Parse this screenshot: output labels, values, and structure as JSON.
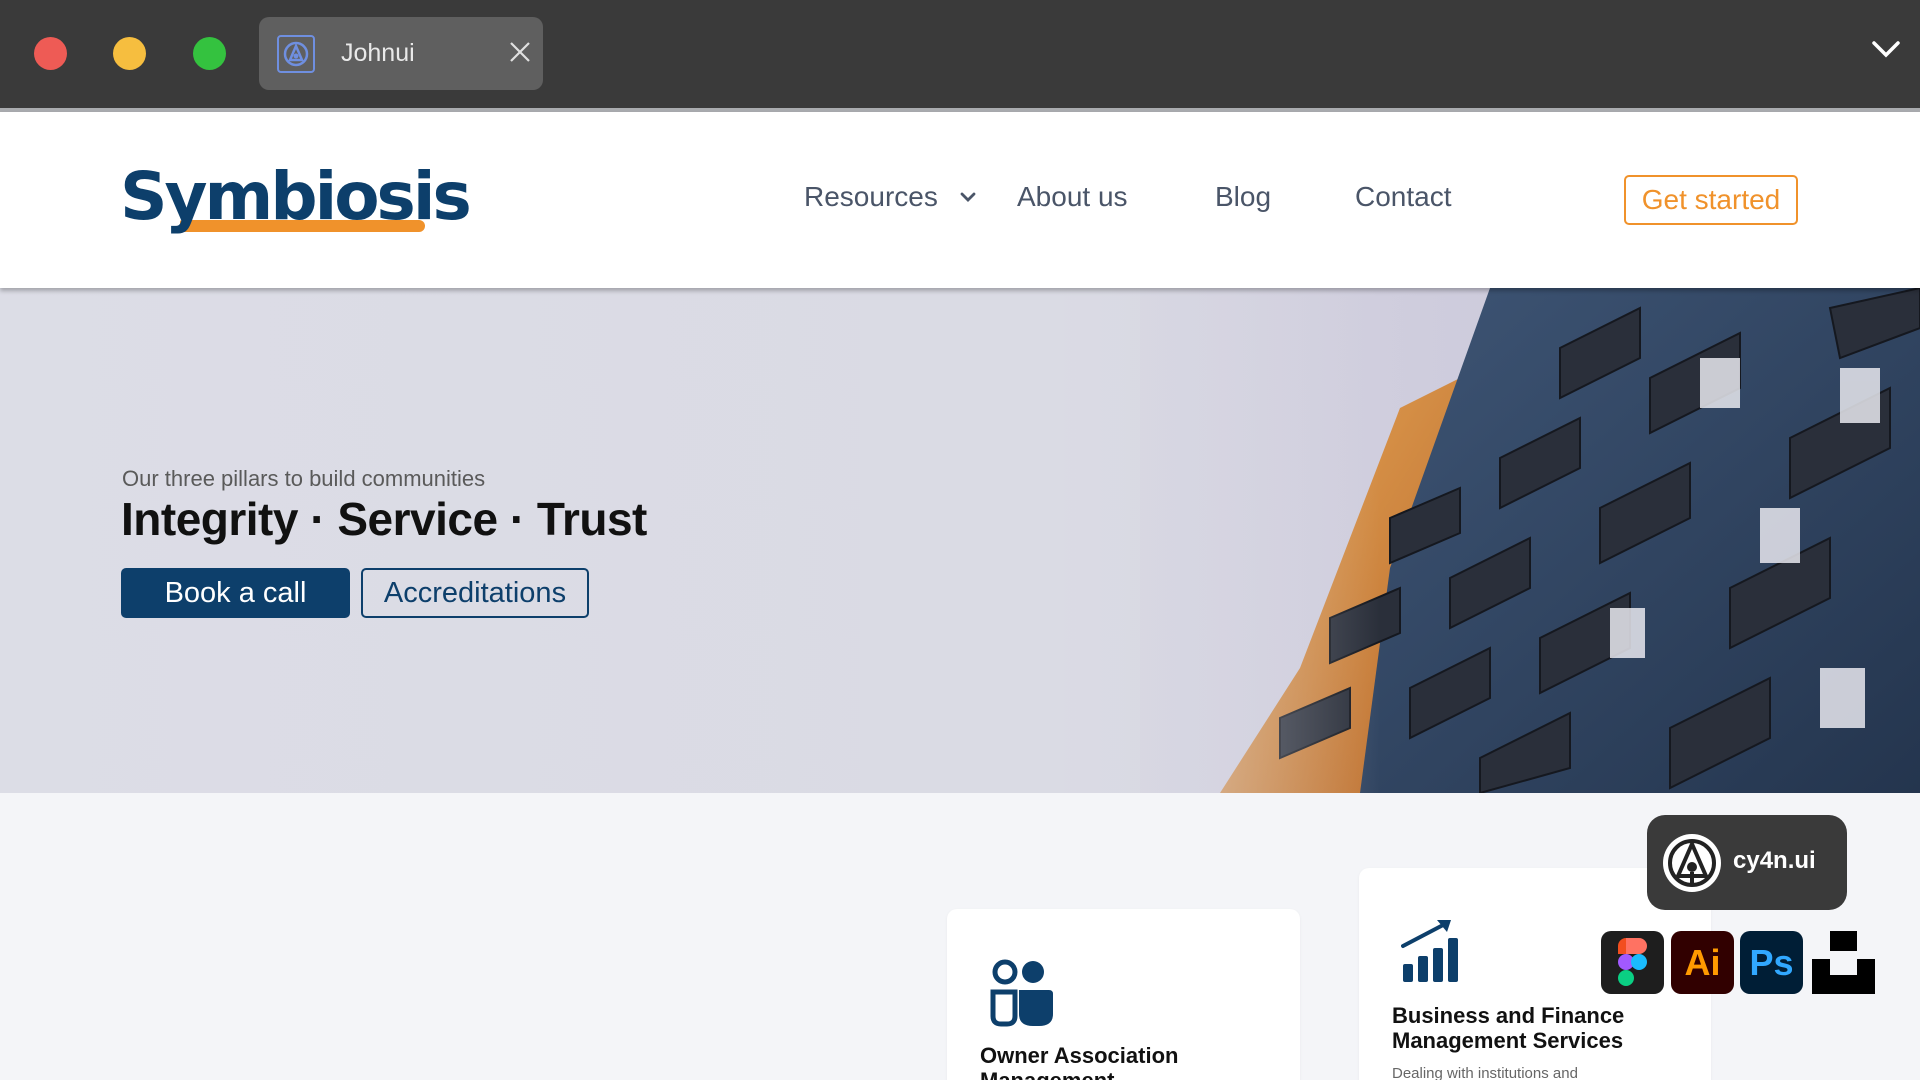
{
  "browser": {
    "tab_title": "Johnui"
  },
  "header": {
    "logo_text": "Symbiosis",
    "nav": {
      "resources": "Resources",
      "about": "About us",
      "blog": "Blog",
      "contact": "Contact"
    },
    "cta": "Get started"
  },
  "hero": {
    "subtitle": "Our three pillars to build communities",
    "title": "Integrity · Service · Trust",
    "primary_button": "Book a call",
    "secondary_button": "Accreditations"
  },
  "services": [
    {
      "title": "Owner Association Management",
      "icon": "people-icon",
      "text": ""
    },
    {
      "title": "Business and Finance Management Services",
      "icon": "bar-chart-growth-icon",
      "text": "Dealing with institutions and"
    }
  ],
  "watermark": {
    "brand": "cy4n.ui",
    "tools": {
      "ai": "Ai",
      "ps": "Ps"
    }
  },
  "colors": {
    "brand_navy": "#0d3f6b",
    "brand_orange": "#f0922b",
    "chrome": "#3a3a3a"
  }
}
